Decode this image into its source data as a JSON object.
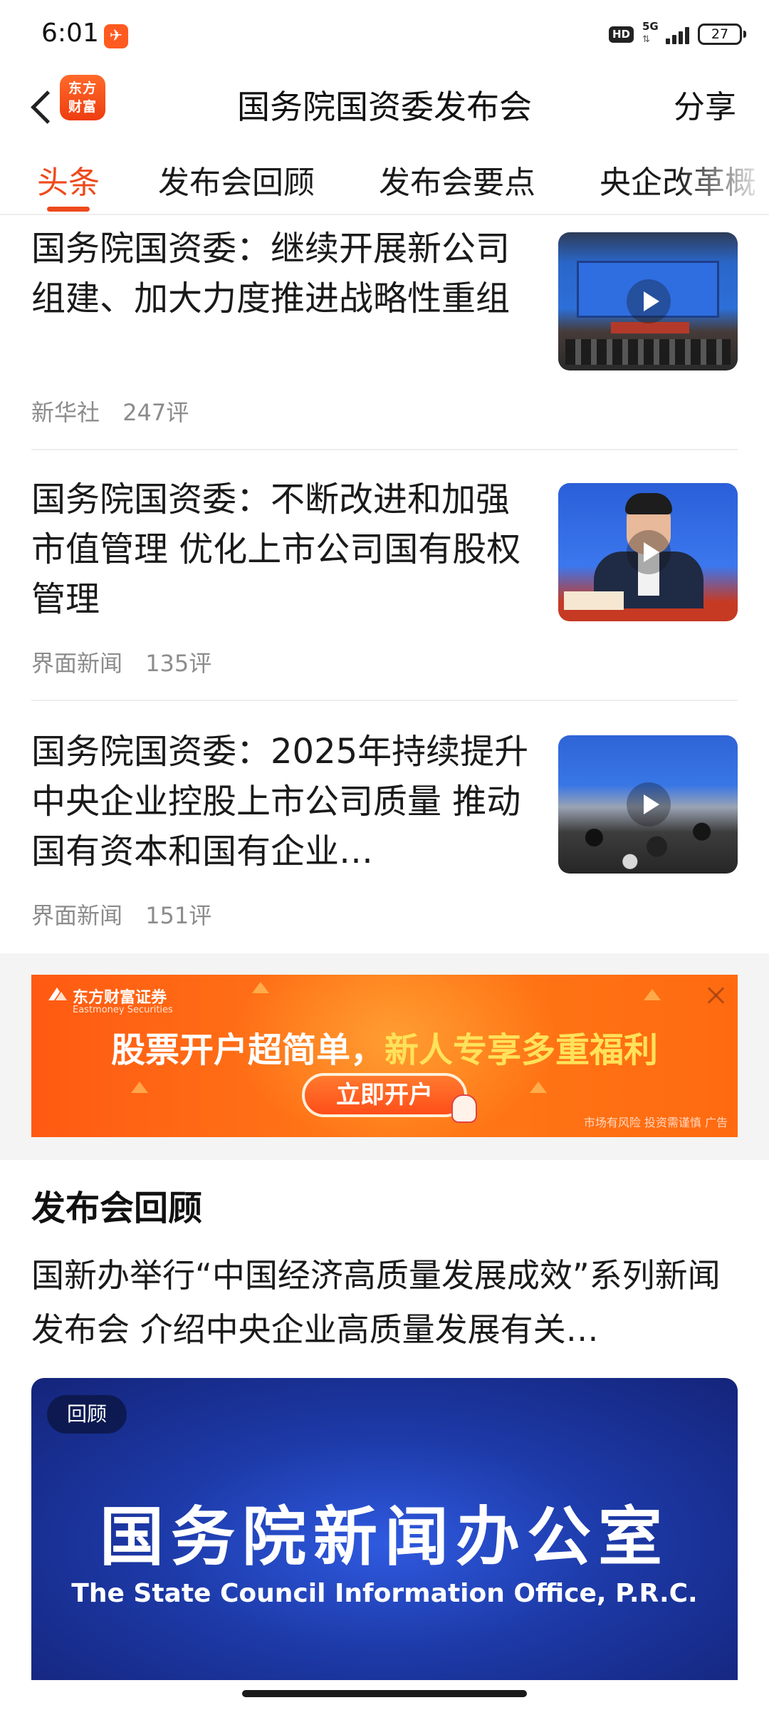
{
  "status_bar": {
    "time": "6:01",
    "app_icon": "✈",
    "hd": "HD",
    "network": "5G",
    "battery": "27"
  },
  "header": {
    "logo_line1": "东方",
    "logo_line2": "财富",
    "title": "国务院国资委发布会",
    "share": "分享"
  },
  "tabs": [
    {
      "label": "头条",
      "active": true
    },
    {
      "label": "发布会回顾"
    },
    {
      "label": "发布会要点"
    },
    {
      "label": "央企改革概"
    }
  ],
  "news": [
    {
      "title": "国务院国资委：继续开展新公司组建、加大力度推进战略性重组",
      "source": "新华社",
      "comments": "247评",
      "thumb_icon": "press-conference-video"
    },
    {
      "title": "国务院国资委：不断改进和加强市值管理 优化上市公司国有股权管理",
      "source": "界面新闻",
      "comments": "135评",
      "thumb_icon": "speaker-video"
    },
    {
      "title": "国务院国资委：2025年持续提升中央企业控股上市公司质量 推动国有资本和国有企业…",
      "source": "界面新闻",
      "comments": "151评",
      "thumb_icon": "reporters-video"
    }
  ],
  "ad": {
    "brand": "东方财富证券",
    "brand_en": "Eastmoney Securities",
    "headline_part1": "股票开户超简单，",
    "headline_part2": "新人专享多重福利",
    "cta": "立即开户",
    "disclaimer": "市场有风险 投资需谨慎 广告",
    "colors": {
      "background": "#ff6a14",
      "highlight": "#ffe25a"
    }
  },
  "recap": {
    "heading": "发布会回顾",
    "text": "国新办举行“中国经济高质量发展成效”系列新闻发布会 介绍中央企业高质量发展有关…",
    "badge": "回顾",
    "banner_cn": "国务院新闻办公室",
    "banner_en": "The State Council Information Office, P.R.C."
  },
  "colors": {
    "accent": "#ee4a1c"
  }
}
